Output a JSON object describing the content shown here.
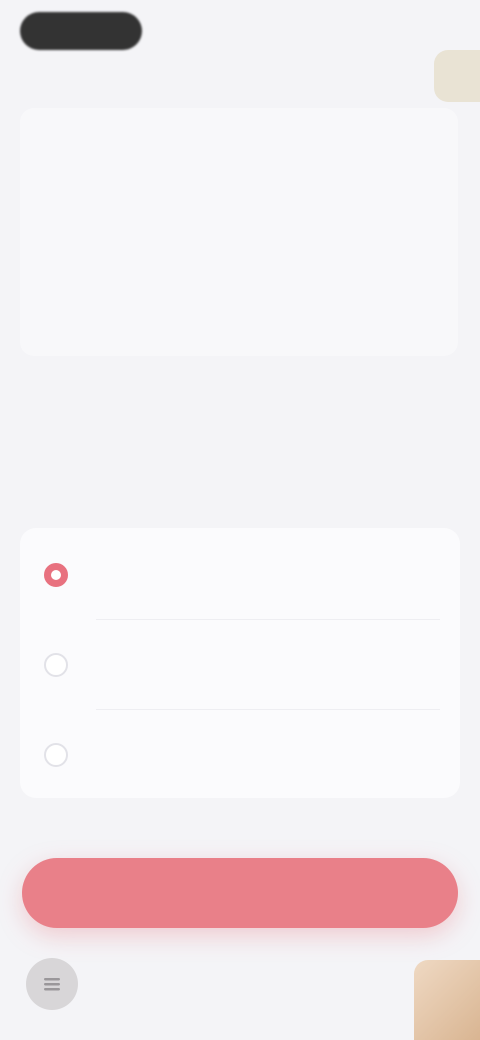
{
  "status_bar": {
    "pill_text": "",
    "right_text": ""
  },
  "description": {
    "heading": "",
    "body": ""
  },
  "section_title": "",
  "options": [
    {
      "label": "",
      "selected": true
    },
    {
      "label": "",
      "selected": false
    },
    {
      "label": "",
      "selected": false
    }
  ],
  "fine_print": "",
  "cta_label": "",
  "colors": {
    "accent": "#e98089",
    "background": "#f4f4f7",
    "card": "#fbfbfd"
  },
  "icons": {
    "bottom_left": "menu-icon",
    "corner_avatar": "avatar",
    "bottom_right": "thumbnail"
  }
}
